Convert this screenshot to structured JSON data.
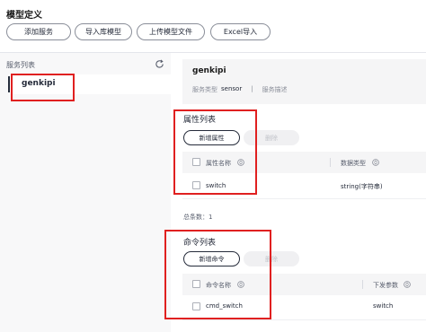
{
  "page": {
    "title": "模型定义"
  },
  "toolbar": {
    "add_service": "添加服务",
    "import_library_model": "导入库模型",
    "upload_model_file": "上传模型文件",
    "excel_import": "Excel导入"
  },
  "sidebar": {
    "title": "服务列表",
    "items": [
      {
        "label": "genkipi",
        "selected": true
      }
    ]
  },
  "service_info": {
    "name": "genkipi",
    "type_label": "服务类型",
    "type_value": "sensor",
    "separator": "|",
    "desc_label": "服务描述"
  },
  "properties": {
    "title": "属性列表",
    "add_button": "新增属性",
    "delete_button": "删除",
    "columns": {
      "name": "属性名称",
      "data_type": "数据类型"
    },
    "rows": [
      {
        "name": "switch",
        "data_type": "string(字符串)"
      }
    ],
    "total": "总条数：1"
  },
  "commands": {
    "title": "命令列表",
    "add_button": "新增命令",
    "delete_button": "删除",
    "columns": {
      "name": "命令名称",
      "params": "下发参数"
    },
    "rows": [
      {
        "name": "cmd_switch",
        "params": "switch"
      }
    ]
  },
  "colors": {
    "highlight_border": "#e02020",
    "panel_bg": "#f8f8f9",
    "text_primary": "#252b3a"
  },
  "icons": {
    "refresh": "refresh-icon",
    "sort": "sort-icon"
  }
}
